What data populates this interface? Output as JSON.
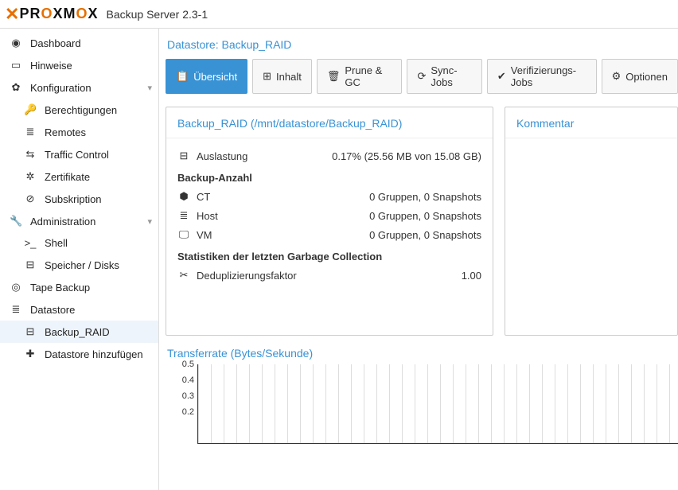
{
  "header": {
    "product": "PROXMOX",
    "title": "Backup Server 2.3-1"
  },
  "sidebar": {
    "items": [
      {
        "icon": "◉",
        "label": "Dashboard"
      },
      {
        "icon": "▭",
        "label": "Hinweise"
      },
      {
        "icon": "✿",
        "label": "Konfiguration",
        "expandable": true
      },
      {
        "icon": "🔑",
        "label": "Berechtigungen",
        "child": true
      },
      {
        "icon": "≣",
        "label": "Remotes",
        "child": true
      },
      {
        "icon": "⇆",
        "label": "Traffic Control",
        "child": true
      },
      {
        "icon": "✲",
        "label": "Zertifikate",
        "child": true
      },
      {
        "icon": "⊘",
        "label": "Subskription",
        "child": true
      },
      {
        "icon": "🔧",
        "label": "Administration",
        "expandable": true
      },
      {
        "icon": ">_",
        "label": "Shell",
        "child": true
      },
      {
        "icon": "⊟",
        "label": "Speicher / Disks",
        "child": true
      },
      {
        "icon": "◎",
        "label": "Tape Backup"
      },
      {
        "icon": "≣",
        "label": "Datastore"
      },
      {
        "icon": "⊟",
        "label": "Backup_RAID",
        "child": true,
        "selected": true
      },
      {
        "icon": "✚",
        "label": "Datastore hinzufügen",
        "child": true
      }
    ]
  },
  "page": {
    "title": "Datastore: Backup_RAID"
  },
  "tabs": [
    {
      "icon": "📋",
      "label": "Übersicht",
      "active": true
    },
    {
      "icon": "⊞",
      "label": "Inhalt"
    },
    {
      "icon": "🗑",
      "label": "Prune & GC"
    },
    {
      "icon": "⟳",
      "label": "Sync-Jobs"
    },
    {
      "icon": "✔",
      "label": "Verifizierungs-Jobs"
    },
    {
      "icon": "⚙",
      "label": "Optionen"
    }
  ],
  "summary": {
    "title": "Backup_RAID (/mnt/datastore/Backup_RAID)",
    "usage": {
      "icon": "⊟",
      "label": "Auslastung",
      "value": "0.17% (25.56 MB von 15.08 GB)"
    },
    "counts_header": "Backup-Anzahl",
    "counts": [
      {
        "icon": "⬢",
        "label": "CT",
        "value": "0 Gruppen, 0 Snapshots"
      },
      {
        "icon": "≣",
        "label": "Host",
        "value": "0 Gruppen, 0 Snapshots"
      },
      {
        "icon": "🖵",
        "label": "VM",
        "value": "0 Gruppen, 0 Snapshots"
      }
    ],
    "gc_header": "Statistiken der letzten Garbage Collection",
    "dedup": {
      "icon": "✂",
      "label": "Deduplizierungsfaktor",
      "value": "1.00"
    }
  },
  "comment": {
    "title": "Kommentar"
  },
  "chart": {
    "title": "Transferrate (Bytes/Sekunde)"
  },
  "chart_data": {
    "type": "line",
    "title": "Transferrate (Bytes/Sekunde)",
    "ylabel": "Bytes/Sekunde",
    "ylim": [
      0,
      0.5
    ],
    "yticks": [
      0.5,
      0.4,
      0.3,
      0.2
    ],
    "series": [
      {
        "name": "Transferrate",
        "values": []
      }
    ]
  }
}
